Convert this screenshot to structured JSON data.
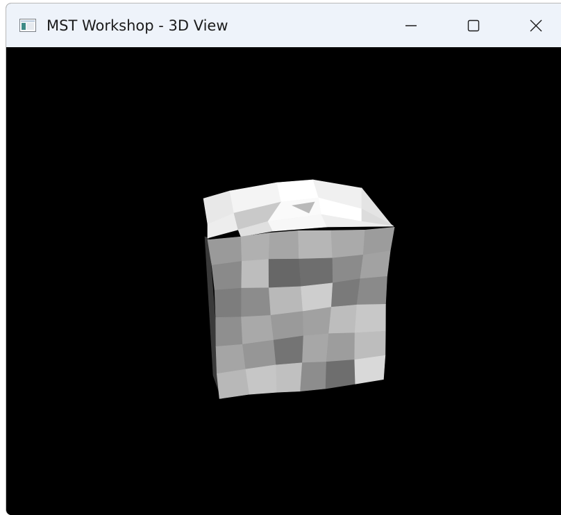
{
  "window": {
    "title": "MST Workshop - 3D View",
    "titlebar_color": "#eef3fa",
    "viewport_background": "#000000"
  },
  "controls": {
    "minimize_icon": "minimize-icon",
    "maximize_icon": "maximize-icon",
    "close_icon": "close-icon"
  },
  "scene": {
    "object": "cube",
    "shading": "grayscale faceted"
  }
}
